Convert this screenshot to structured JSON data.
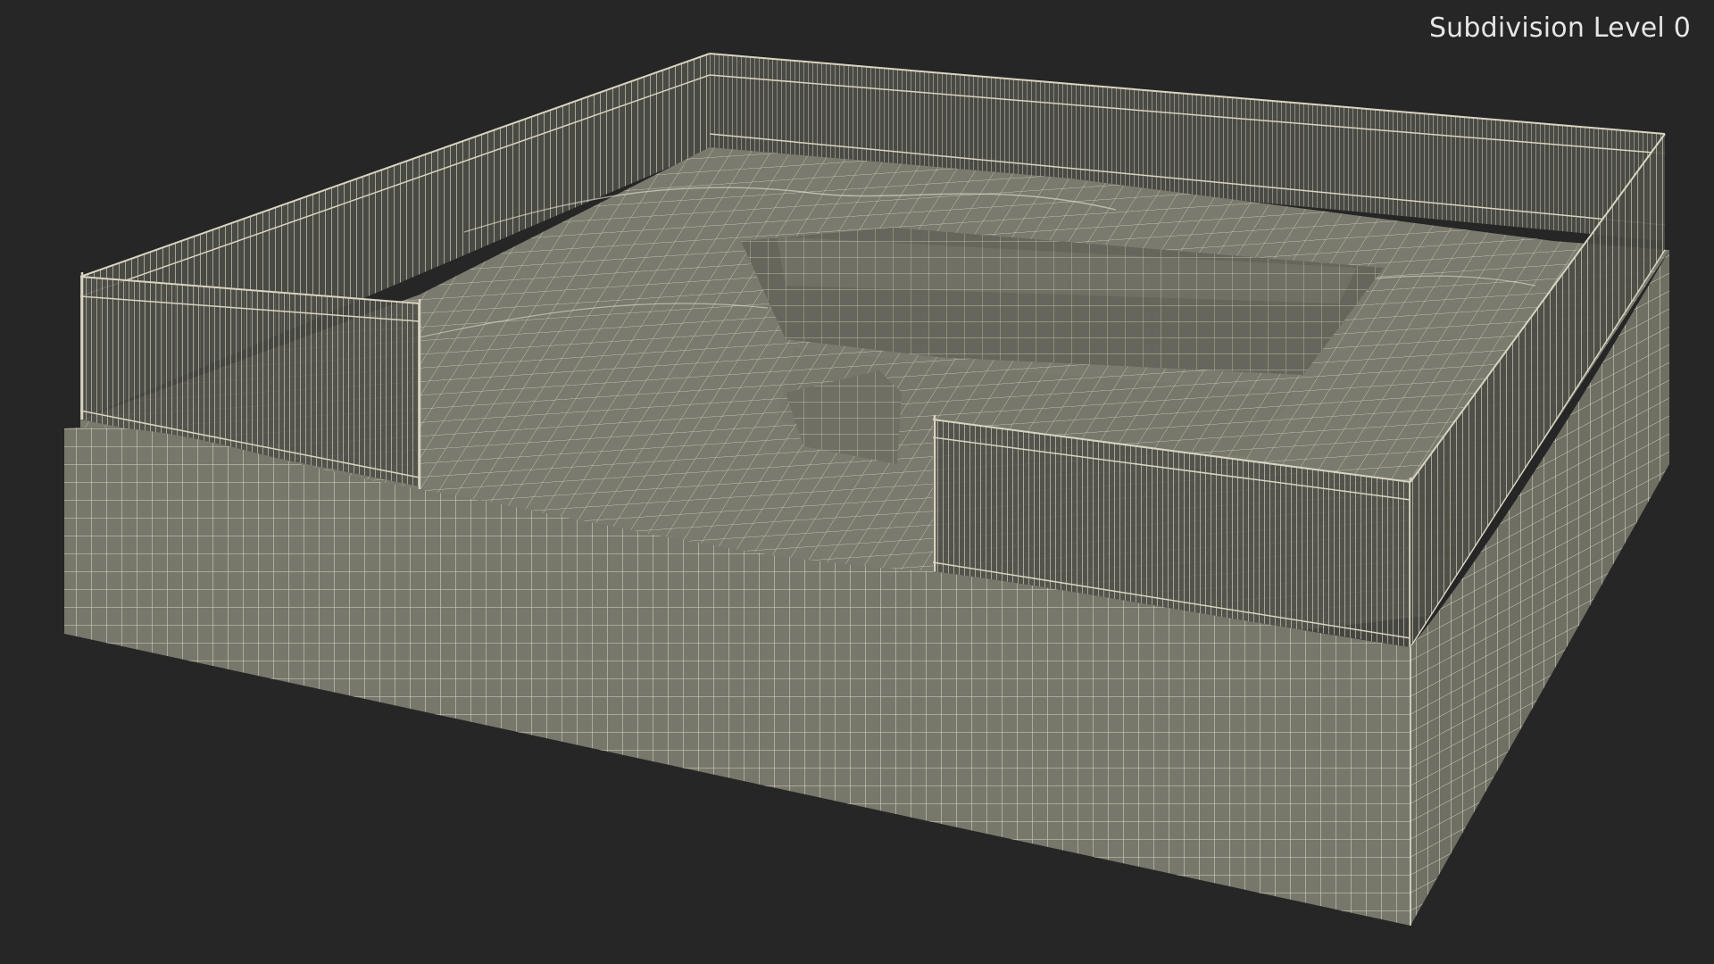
{
  "viewport": {
    "label": "Subdivision Level 0",
    "background_color": "#262626"
  },
  "model": {
    "type": "wireframe-terrain-with-fence",
    "mesh_fill_color": "#79796d",
    "mesh_shadow_color": "#6b6b60",
    "mesh_side_color": "#76766a",
    "wire_color": "#e9e5d3",
    "fence_color": "#c9c6b4"
  }
}
